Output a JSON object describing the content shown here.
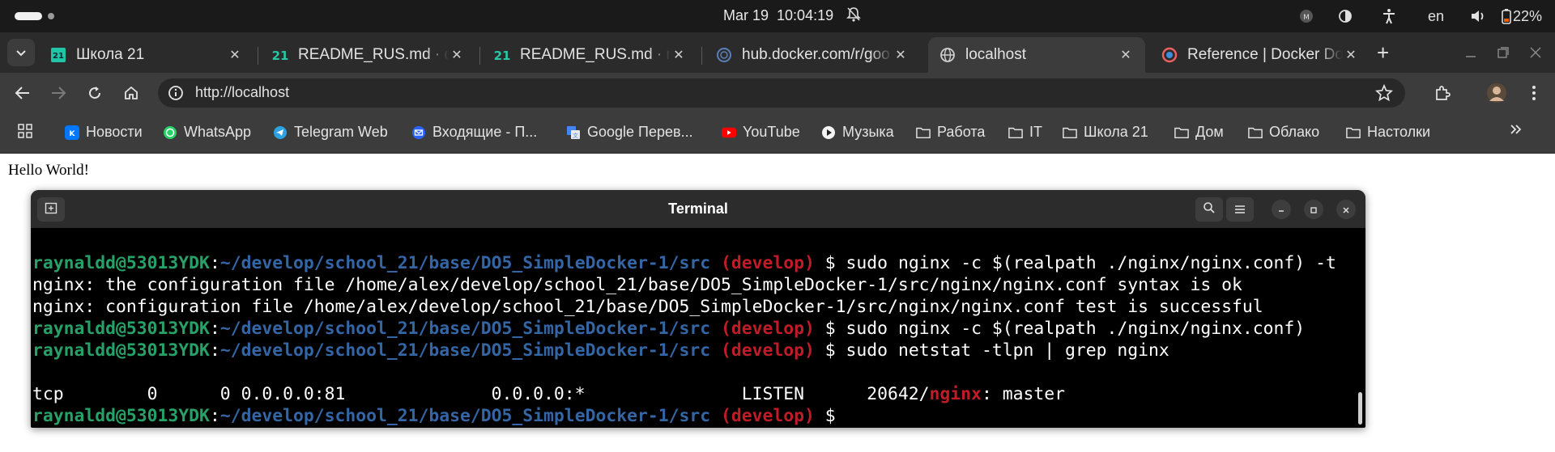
{
  "topbar": {
    "date": "Mar 19",
    "time": "10:04:19",
    "language": "en",
    "battery": "22%"
  },
  "tabs": [
    {
      "title": "Школа 21",
      "active": false
    },
    {
      "title": "README_RUS.md · de",
      "active": false
    },
    {
      "title": "README_RUS.md · ma",
      "active": false
    },
    {
      "title": "hub.docker.com/r/goo",
      "active": false
    },
    {
      "title": "localhost",
      "active": true
    },
    {
      "title": "Reference | Docker Do",
      "active": false
    }
  ],
  "newtab_label": "+",
  "omnibox": {
    "url": "http://localhost"
  },
  "bookmarks": [
    {
      "label": "Новости",
      "icon": "vk-icon"
    },
    {
      "label": "WhatsApp",
      "icon": "whatsapp-icon"
    },
    {
      "label": "Telegram Web",
      "icon": "telegram-icon"
    },
    {
      "label": "Входящие - П...",
      "icon": "mail-icon"
    },
    {
      "label": "Google Перев...",
      "icon": "translate-icon"
    },
    {
      "label": "YouTube",
      "icon": "youtube-icon"
    },
    {
      "label": "Музыка",
      "icon": "music-icon"
    },
    {
      "label": "Работа",
      "icon": "folder-icon"
    },
    {
      "label": "IT",
      "icon": "folder-icon"
    },
    {
      "label": "Школа 21",
      "icon": "folder-icon"
    },
    {
      "label": "Дом",
      "icon": "folder-icon"
    },
    {
      "label": "Облако",
      "icon": "folder-icon"
    },
    {
      "label": "Настолки",
      "icon": "folder-icon"
    }
  ],
  "page": {
    "text": "Hello World!"
  },
  "terminal": {
    "title": "Terminal",
    "user_host": "raynaldd@53013YDK",
    "path": "~/develop/school_21/base/DO5_SimpleDocker-1/src",
    "branch": "(develop)",
    "commands": [
      "sudo nginx -c $(realpath ./nginx/nginx.conf) -t",
      "sudo nginx -c $(realpath ./nginx/nginx.conf)",
      "sudo netstat -tlpn | grep nginx"
    ],
    "outputs": [
      "nginx: the configuration file /home/alex/develop/school_21/base/DO5_SimpleDocker-1/src/nginx/nginx.conf syntax is ok",
      "nginx: configuration file /home/alex/develop/school_21/base/DO5_SimpleDocker-1/src/nginx/nginx.conf test is successful"
    ],
    "netstat_prefix": "tcp        0      0 0.0.0.0:81              0.0.0.0:*               LISTEN      20642/",
    "netstat_match": "nginx",
    "netstat_suffix": ": master",
    "sep": ":",
    "dollar": " $ "
  },
  "colors": {
    "user": "#26a269",
    "path": "#3465a4",
    "branch": "#c01c28"
  }
}
